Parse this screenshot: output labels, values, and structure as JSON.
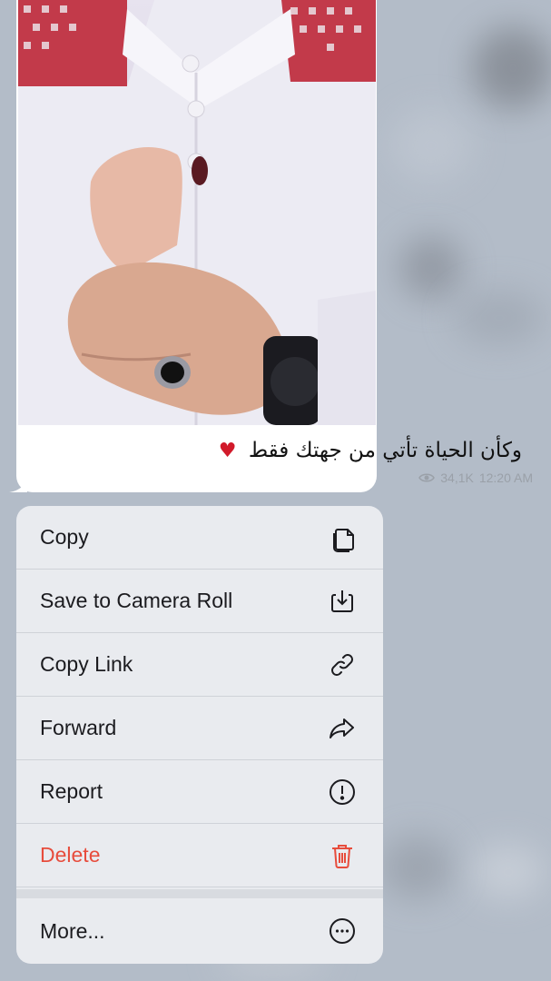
{
  "message": {
    "caption": "وكأن الحياة تأتي من جهتك فقط",
    "caption_emoji": "♥",
    "views": "34,1K",
    "time": "12:20 AM"
  },
  "menu": {
    "items": [
      {
        "label": "Copy",
        "icon": "copy-icon"
      },
      {
        "label": "Save to Camera Roll",
        "icon": "download-icon"
      },
      {
        "label": "Copy Link",
        "icon": "link-icon"
      },
      {
        "label": "Forward",
        "icon": "forward-icon"
      },
      {
        "label": "Report",
        "icon": "report-icon"
      },
      {
        "label": "Delete",
        "icon": "trash-icon"
      },
      {
        "label": "More...",
        "icon": "more-icon"
      }
    ]
  },
  "colors": {
    "danger": "#e74c3c",
    "menu_bg": "#e9ebef"
  }
}
